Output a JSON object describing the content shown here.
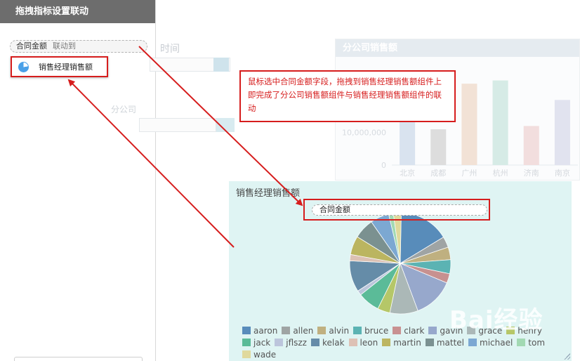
{
  "left_panel": {
    "title": "拖拽指标设置联动",
    "field": {
      "name": "合同金额",
      "action": "联动到"
    },
    "target": {
      "label": "销售经理销售额"
    }
  },
  "dashboard": {
    "filter_label": "时间",
    "filter2_label": "分公司",
    "bar_widget": {
      "title": "分公司销售额"
    },
    "pie_widget": {
      "title": "销售经理销售额",
      "dropped_field": "合同金额"
    }
  },
  "callout": {
    "text": "鼠标选中合同金额字段，拖拽到销售经理销售额组件上即完成了分公司销售额组件与销售经理销售额组件的联动"
  },
  "watermark": "Bai经验",
  "colors": {
    "annotation_red": "#d61d1d",
    "header_gray": "#6d6d6d",
    "pie_bg": "#dff4f3"
  },
  "chart_data": [
    {
      "type": "bar",
      "title": "分公司销售额",
      "categories": [
        "北京",
        "成都",
        "广州",
        "杭州",
        "济南",
        "南京"
      ],
      "values": [
        28000000,
        11000000,
        25000000,
        26000000,
        12000000,
        20000000
      ],
      "yticks": [
        "0",
        "10,000,000",
        "20,000,000"
      ],
      "ylim": [
        0,
        30000000
      ],
      "color": "#d5dde6"
    },
    {
      "type": "pie",
      "title": "销售经理销售额",
      "legend": "bottom",
      "series": [
        {
          "name": "aaron",
          "value": 16,
          "color": "#2b6aa8"
        },
        {
          "name": "allen",
          "value": 3.5,
          "color": "#8a8a8a"
        },
        {
          "name": "alvin",
          "value": 4,
          "color": "#b59a5a"
        },
        {
          "name": "bruce",
          "value": 4.5,
          "color": "#2f9e9e"
        },
        {
          "name": "clark",
          "value": 3,
          "color": "#c07070"
        },
        {
          "name": "gavin",
          "value": 13,
          "color": "#7f8fbf"
        },
        {
          "name": "grace",
          "value": 9,
          "color": "#9aa4a4"
        },
        {
          "name": "henry",
          "value": 4,
          "color": "#a8b83a"
        },
        {
          "name": "jack",
          "value": 7,
          "color": "#2fa87a"
        },
        {
          "name": "jflszz",
          "value": 1.5,
          "color": "#b0b6d4"
        },
        {
          "name": "kelak",
          "value": 10,
          "color": "#3d6a90"
        },
        {
          "name": "leon",
          "value": 2,
          "color": "#dcb0a0"
        },
        {
          "name": "martin",
          "value": 6,
          "color": "#b0a030"
        },
        {
          "name": "mattel",
          "value": 6.5,
          "color": "#5a7070"
        },
        {
          "name": "michael",
          "value": 6,
          "color": "#5b8fc8"
        },
        {
          "name": "tom",
          "value": 1.5,
          "color": "#8ed09e"
        },
        {
          "name": "wade",
          "value": 2.5,
          "color": "#e0d080"
        }
      ]
    }
  ]
}
